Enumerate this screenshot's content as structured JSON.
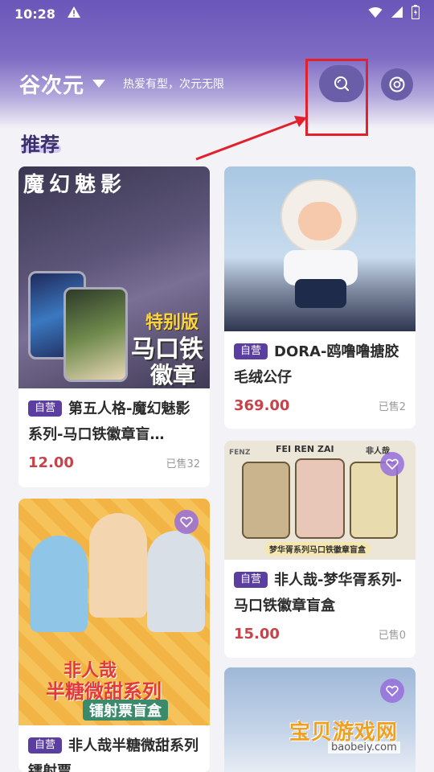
{
  "status": {
    "time": "10:28"
  },
  "header": {
    "title": "谷次元",
    "slogan": "热爱有型，次元无限"
  },
  "section": {
    "title": "推荐"
  },
  "badge_label": "自营",
  "products": [
    {
      "name": "第五人格-魔幻魅影系列-马口铁徽章盲…",
      "price": "12.00",
      "sold": "已售32",
      "image_text_top": "魔幻魅影",
      "image_text_a": "特别版",
      "image_text_b": "马口铁",
      "image_text_c": "徽章"
    },
    {
      "name": "DORA-鸥噜噜搪胶毛绒公仔",
      "price": "369.00",
      "sold": "已售2"
    },
    {
      "name": "非人哉-梦华胥系列-马口铁徽章盲盒",
      "price": "15.00",
      "sold": "已售0",
      "image_text_top": "FEI REN ZAI",
      "image_text_left": "FENZ",
      "image_text_right": "非人哉",
      "image_text_bottom": "梦华胥系列马口铁徽章盲盒"
    },
    {
      "name": "非人哉半糖微甜系列镭射票",
      "price": "",
      "sold": "",
      "image_text_a": "非人哉",
      "image_text_b": "半糖微甜系列",
      "image_text_c": "镭射票盲盒"
    }
  ],
  "watermark": {
    "main": "宝贝游戏网",
    "sub": "baobeiy.com"
  },
  "colors": {
    "header": "#6a56b8",
    "badge": "#5a3fa0",
    "price": "#c8424a",
    "highlight": "#e1212b"
  }
}
